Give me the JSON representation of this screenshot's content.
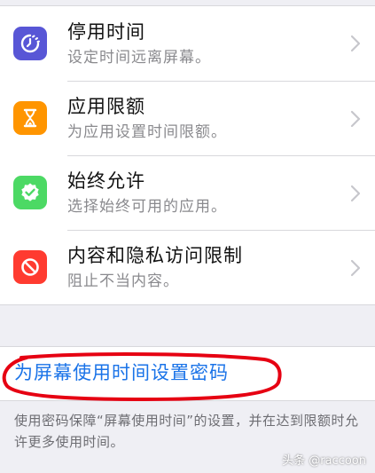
{
  "settings_rows": [
    {
      "title": "停用时间",
      "subtitle": "设定时间远离屏幕。",
      "icon": "downtime-icon",
      "color": "#5856d6"
    },
    {
      "title": "应用限额",
      "subtitle": "为应用设置时间限额。",
      "icon": "hourglass-icon",
      "color": "#ff9500"
    },
    {
      "title": "始终允许",
      "subtitle": "选择始终可用的应用。",
      "icon": "checkmark-badge-icon",
      "color": "#4cd964"
    },
    {
      "title": "内容和隐私访问限制",
      "subtitle": "阻止不当内容。",
      "icon": "restriction-icon",
      "color": "#ff3b30"
    }
  ],
  "passcode": {
    "label": "为屏幕使用时间设置密码",
    "link_color": "#1a73e8",
    "annotation_color": "#e60012"
  },
  "footnote": "使用密码保障“屏幕使用时间”的设置，并在达到限额时允许更多使用时间。",
  "watermark": "头条 @raccoon"
}
